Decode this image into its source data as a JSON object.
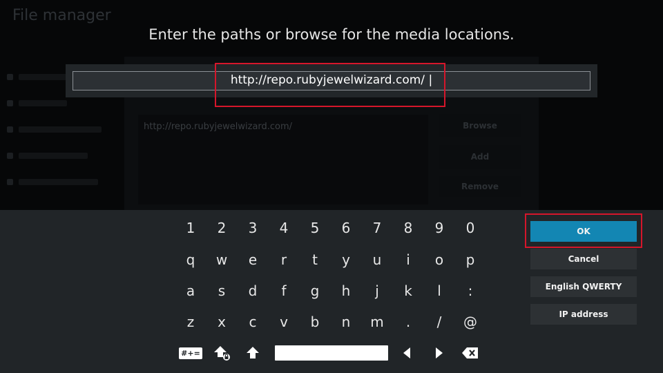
{
  "background": {
    "window_title": "File manager",
    "source_path": "http://repo.rubyjewelwizard.com/",
    "buttons": [
      "Browse",
      "Add",
      "Remove"
    ]
  },
  "dialog": {
    "heading": "Enter the paths or browse for the media locations.",
    "input_value": "http://repo.rubyjewelwizard.com/ |"
  },
  "keyboard": {
    "rows": [
      [
        "1",
        "2",
        "3",
        "4",
        "5",
        "6",
        "7",
        "8",
        "9",
        "0"
      ],
      [
        "q",
        "w",
        "e",
        "r",
        "t",
        "y",
        "u",
        "i",
        "o",
        "p"
      ],
      [
        "a",
        "s",
        "d",
        "f",
        "g",
        "h",
        "j",
        "k",
        "l",
        ":"
      ],
      [
        "z",
        "x",
        "c",
        "v",
        "b",
        "n",
        "m",
        ".",
        "/",
        "@"
      ]
    ],
    "symbols_label": "#+="
  },
  "buttons": {
    "ok": "OK",
    "cancel": "Cancel",
    "layout": "English QWERTY",
    "ip": "IP address"
  },
  "colors": {
    "accent": "#1386b3",
    "highlight": "#d6162b"
  }
}
